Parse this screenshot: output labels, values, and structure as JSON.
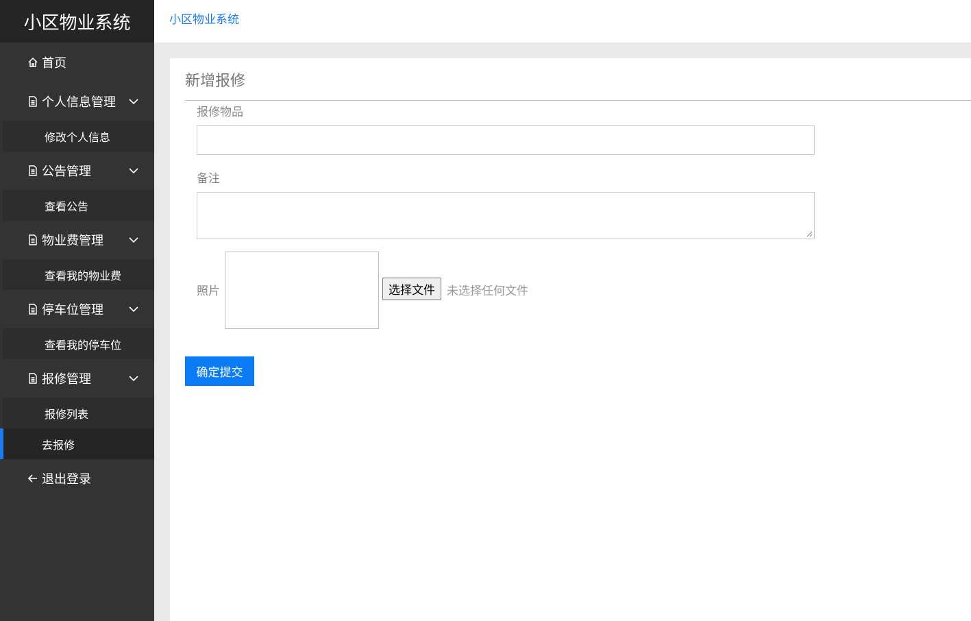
{
  "app": {
    "title": "小区物业系统"
  },
  "header": {
    "breadcrumb": "小区物业系统"
  },
  "sidebar": {
    "home": {
      "label": "首页",
      "icon": "home-icon"
    },
    "groups": [
      {
        "label": "个人信息管理",
        "icon": "document-icon",
        "items": [
          "修改个人信息"
        ]
      },
      {
        "label": "公告管理",
        "icon": "document-icon",
        "items": [
          "查看公告"
        ]
      },
      {
        "label": "物业费管理",
        "icon": "document-icon",
        "items": [
          "查看我的物业费"
        ]
      },
      {
        "label": "停车位管理",
        "icon": "document-icon",
        "items": [
          "查看我的停车位"
        ]
      },
      {
        "label": "报修管理",
        "icon": "document-icon",
        "items": [
          "报修列表",
          "去报修"
        ]
      }
    ],
    "active_item": "去报修",
    "logout": {
      "label": "退出登录",
      "icon": "arrow-left-icon"
    }
  },
  "form": {
    "title": "新增报修",
    "item_label": "报修物品",
    "item_value": "",
    "note_label": "备注",
    "note_value": "",
    "photo_label": "照片",
    "file_button": "选择文件",
    "file_status": "未选择任何文件",
    "submit_label": "确定提交"
  },
  "colors": {
    "sidebar_bg": "#333333",
    "accent": "#1e7cf2",
    "submit": "#0a7bf5"
  }
}
